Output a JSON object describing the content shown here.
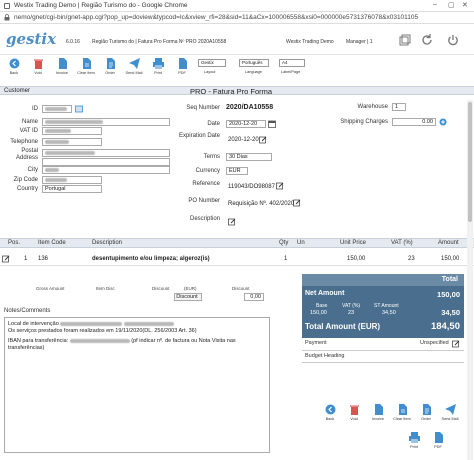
{
  "window": {
    "title": "Westix Trading Demo | Região Turismo do - Google Chrome",
    "url": "nemo/gnet/cgi-bin/gnet-app.cgi?pop_up=doview&typcod=Ic&xview_rfi=28&sid=11&aCx=100006558&xsi0=000000e5731376078&x03101105"
  },
  "header": {
    "logo": "gestix",
    "version": "6.0.16",
    "breadcrumb": "Região Turismo do | Fatura Pro Forma Nº PRO 2020A10558",
    "company": "Westix Trading Demo",
    "user": "Manager | 1"
  },
  "toolbar": {
    "buttons": [
      {
        "label": "Back"
      },
      {
        "label": "Void"
      },
      {
        "label": "Invoice"
      },
      {
        "label": "Clear Item"
      },
      {
        "label": "Order"
      },
      {
        "label": "Send Mail"
      },
      {
        "label": "Print"
      },
      {
        "label": "PDF"
      }
    ],
    "company_select": "Gestix",
    "company_select_label": "Layout",
    "language_select": "Português",
    "language_label": "Language",
    "paper_select": "A4",
    "paper_label": "Label/Page"
  },
  "section": {
    "customer_label": "Customer",
    "doc_title": "PRO - Fatura Pro Forma"
  },
  "customer": {
    "id_label": "ID",
    "name_label": "Name",
    "vat_label": "VAT ID",
    "phone_label": "Telephone",
    "address_label": "Postal Address",
    "city_label": "City",
    "zip_label": "Zip Code",
    "country_label": "Country",
    "country_value": "Portugal"
  },
  "document": {
    "seq_label": "Seq Number",
    "seq_value": "2020/DA10558",
    "date_label": "Date",
    "date_value": "2020-12-20",
    "exp_label": "Expiration Date",
    "exp_value": "2020-12-20",
    "terms_label": "Terms",
    "terms_value": "30 Dias",
    "currency_label": "Currency",
    "currency_value": "EUR",
    "reference_label": "Reference",
    "reference_value": "119043/DO98087",
    "po_label": "PO Number",
    "po_value": "Requisição Nº. 402/2020",
    "description_label": "Description"
  },
  "right": {
    "warehouse_label": "Warehouse",
    "warehouse_value": "1",
    "shipping_label": "Shipping Charges",
    "shipping_value": "0.00"
  },
  "items": {
    "headers": [
      "Pos.",
      "Item Code",
      "Description",
      "Qty",
      "Un",
      "Unit Price",
      "VAT (%)",
      "Amount"
    ],
    "rows": [
      {
        "pos": "1",
        "code": "136",
        "description": "desentupimento e/ou limpeza; algeroz(is)",
        "qty": "1",
        "unit_price": "150,00",
        "vat": "23",
        "amount": "150,00"
      }
    ]
  },
  "discount": {
    "gross_label": "Gross Amount",
    "item_label": "Item Disc",
    "discount_label": "Discount",
    "currency_label": "(EUR)",
    "discount_button": "Discount",
    "value": "0,00"
  },
  "notes": {
    "label": "Notes/Comments",
    "line1": "Local de intervenção",
    "line2": "Os serviços prestados foram realizados em 19/11/2020(DL. 256/2003 Art. 36)",
    "line3": "IBAN para transferência:",
    "line3b": "(pf indicar nº. de factura ou Nota Visita nas",
    "line4": "transferências)"
  },
  "totals": {
    "header": "Total",
    "net_label": "Net Amount",
    "net_value": "150,00",
    "base_label": "Base",
    "base_value": "150,00",
    "vat_label": "VAT (%)",
    "vat_value": "23",
    "st_label": "ST Amount",
    "st_value": "34,50",
    "st_total": "34,50",
    "total_label": "Total Amount (EUR)",
    "total_value": "184,50"
  },
  "payment": {
    "label": "Payment",
    "value": "Unspecified",
    "budget_label": "Budget Heading"
  },
  "bottom_actions": [
    {
      "label": "Back"
    },
    {
      "label": "Void"
    },
    {
      "label": "Invoice"
    },
    {
      "label": "Clear Item"
    },
    {
      "label": "Order"
    },
    {
      "label": "Send Mail"
    },
    {
      "label": "Print"
    },
    {
      "label": "PDF"
    }
  ]
}
